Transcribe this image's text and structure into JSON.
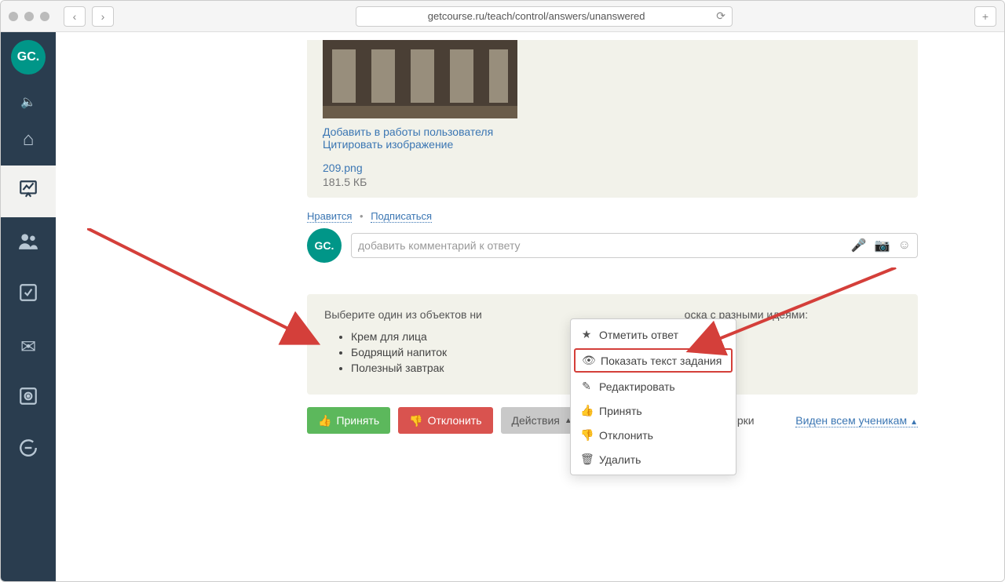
{
  "browser": {
    "url": "getcourse.ru/teach/control/answers/unanswered"
  },
  "logo": "GC.",
  "attachment": {
    "add_label": "Добавить в работы пользователя",
    "quote_label": "Цитировать изображение",
    "filename": "209.png",
    "filesize": "181.5 КБ"
  },
  "post": {
    "like": "Нравится",
    "subscribe": "Подписаться"
  },
  "comment": {
    "placeholder": "добавить комментарий к ответу",
    "avatar": "GC."
  },
  "task": {
    "prompt_before": "Выберите один из объектов ни",
    "prompt_after": "оска с разными идеями:",
    "items": [
      "Крем для лица",
      "Бодрящий напиток",
      "Полезный завтрак"
    ]
  },
  "buttons": {
    "accept": "Принять",
    "reject": "Отклонить",
    "actions": "Действия"
  },
  "status": "Задание ожидает проверки",
  "visibility": "Виден всем ученикам",
  "dropdown": {
    "mark": "Отметить ответ",
    "show_task": "Показать текст задания",
    "edit": "Редактировать",
    "accept": "Принять",
    "reject": "Отклонить",
    "delete": "Удалить"
  }
}
